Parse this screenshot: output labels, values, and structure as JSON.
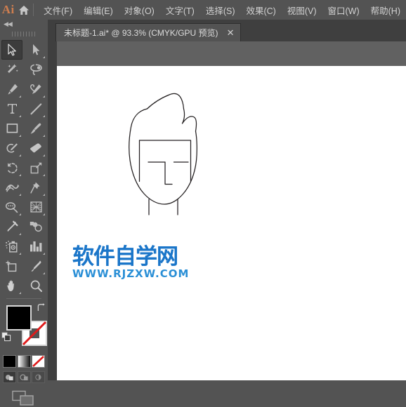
{
  "app": {
    "logo_text": "Ai",
    "home_icon": "home-icon"
  },
  "menu": {
    "items": [
      {
        "label": "文件(F)",
        "name": "menu-file"
      },
      {
        "label": "编辑(E)",
        "name": "menu-edit"
      },
      {
        "label": "对象(O)",
        "name": "menu-object"
      },
      {
        "label": "文字(T)",
        "name": "menu-type"
      },
      {
        "label": "选择(S)",
        "name": "menu-select"
      },
      {
        "label": "效果(C)",
        "name": "menu-effect"
      },
      {
        "label": "视图(V)",
        "name": "menu-view"
      },
      {
        "label": "窗口(W)",
        "name": "menu-window"
      },
      {
        "label": "帮助(H)",
        "name": "menu-help"
      }
    ]
  },
  "document_tab": {
    "title": "未标题-1.ai* @ 93.3% (CMYK/GPU 预览)",
    "close_label": "✕",
    "zoom_level": "93.3%",
    "color_mode": "CMYK/GPU 预览",
    "file_name": "未标题-1.ai*"
  },
  "toolbar": {
    "collapse_label": "◀◀",
    "tools": [
      {
        "name": "selection-tool",
        "icon": "arrow-cursor-icon",
        "active": true,
        "has_flyout": false
      },
      {
        "name": "direct-selection-tool",
        "icon": "white-arrow-cursor-icon",
        "active": false,
        "has_flyout": true
      },
      {
        "name": "magic-wand-tool",
        "icon": "magic-wand-icon",
        "active": false,
        "has_flyout": false
      },
      {
        "name": "lasso-tool",
        "icon": "lasso-icon",
        "active": false,
        "has_flyout": false
      },
      {
        "name": "pen-tool",
        "icon": "pen-nib-icon",
        "active": false,
        "has_flyout": true
      },
      {
        "name": "curvature-tool",
        "icon": "curvature-pen-icon",
        "active": false,
        "has_flyout": true
      },
      {
        "name": "type-tool",
        "icon": "type-T-icon",
        "active": false,
        "has_flyout": true
      },
      {
        "name": "line-segment-tool",
        "icon": "line-segment-icon",
        "active": false,
        "has_flyout": true
      },
      {
        "name": "rectangle-tool",
        "icon": "rectangle-icon",
        "active": false,
        "has_flyout": true
      },
      {
        "name": "paintbrush-tool",
        "icon": "paintbrush-icon",
        "active": false,
        "has_flyout": true
      },
      {
        "name": "shaper-tool",
        "icon": "shaper-pencil-icon",
        "active": false,
        "has_flyout": true
      },
      {
        "name": "eraser-tool",
        "icon": "eraser-icon",
        "active": false,
        "has_flyout": true
      },
      {
        "name": "rotate-tool",
        "icon": "rotate-icon",
        "active": false,
        "has_flyout": true
      },
      {
        "name": "scale-tool",
        "icon": "scale-icon",
        "active": false,
        "has_flyout": true
      },
      {
        "name": "width-tool",
        "icon": "width-warp-icon",
        "active": false,
        "has_flyout": true
      },
      {
        "name": "free-transform-tool",
        "icon": "pin-transform-icon",
        "active": false,
        "has_flyout": true
      },
      {
        "name": "shape-builder-tool",
        "icon": "shape-builder-icon",
        "active": false,
        "has_flyout": true
      },
      {
        "name": "perspective-grid-tool",
        "icon": "perspective-grid-icon",
        "active": false,
        "has_flyout": true
      },
      {
        "name": "eyedropper-tool",
        "icon": "eyedropper-icon",
        "active": false,
        "has_flyout": true
      },
      {
        "name": "blend-tool",
        "icon": "blend-circles-icon",
        "active": false,
        "has_flyout": false
      },
      {
        "name": "symbol-sprayer-tool",
        "icon": "symbol-sprayer-icon",
        "active": false,
        "has_flyout": true
      },
      {
        "name": "column-graph-tool",
        "icon": "bar-graph-icon",
        "active": false,
        "has_flyout": true
      },
      {
        "name": "artboard-tool",
        "icon": "artboard-icon",
        "active": false,
        "has_flyout": false
      },
      {
        "name": "slice-tool",
        "icon": "slice-knife-icon",
        "active": false,
        "has_flyout": true
      },
      {
        "name": "hand-tool",
        "icon": "hand-icon",
        "active": false,
        "has_flyout": true
      },
      {
        "name": "zoom-tool",
        "icon": "magnifier-icon",
        "active": false,
        "has_flyout": false
      }
    ],
    "fill_color": "#000000",
    "stroke_color": "none",
    "swap_icon": "swap-fill-stroke-icon",
    "default_icon": "default-fill-stroke-icon",
    "paint_modes": [
      {
        "name": "color-mode-button",
        "label": "solid-color-icon"
      },
      {
        "name": "gradient-mode-button",
        "label": "gradient-icon"
      },
      {
        "name": "none-mode-button",
        "label": "none-swatch-icon"
      }
    ],
    "draw_modes": [
      {
        "name": "draw-normal-button",
        "label": "draw-normal-icon",
        "selected": true
      },
      {
        "name": "draw-behind-button",
        "label": "draw-behind-icon",
        "selected": false
      },
      {
        "name": "draw-inside-button",
        "label": "draw-inside-icon",
        "selected": false
      }
    ],
    "screen_mode": {
      "name": "change-screen-mode-button",
      "label": "screen-mode-icon"
    }
  },
  "watermark": {
    "chinese": "软件自学网",
    "url": "WWW.RJZXW.COM",
    "color": "#1b76c9"
  },
  "artwork": {
    "title": "face-head-line-drawing",
    "stroke_color": "#231f20",
    "stroke_width": 1.2
  },
  "colors": {
    "menu_bg": "#535353",
    "panel_bg": "#535353",
    "workspace_bg": "#616161",
    "tab_strip_bg": "#3f3f3f",
    "artboard_bg": "#ffffff",
    "accent_logo": "#cf7e4f",
    "text": "#d2d2d2"
  }
}
